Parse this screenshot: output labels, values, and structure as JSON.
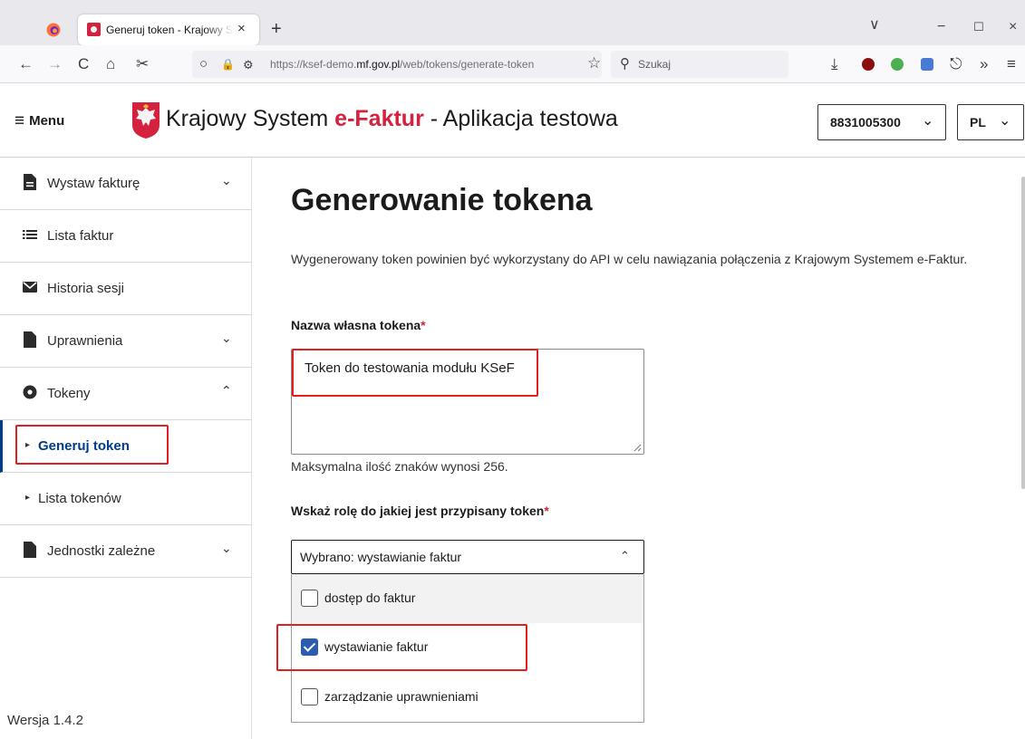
{
  "browser": {
    "tab_title": "Generuj token - Krajowy System e-Faktur",
    "url_prefix": "https://ksef-demo.",
    "url_domain": "mf.gov.pl",
    "url_path": "/web/tokens/generate-token",
    "search_placeholder": "Szukaj",
    "new_tab": "+",
    "tab_close": "×",
    "list_all_tabs": "∨",
    "minimize": "−",
    "maximize": "☐",
    "close": "×",
    "back": "←",
    "forward": "→",
    "reload": "C",
    "home": "⌂",
    "screenshot": "✂",
    "tracking_protection": "○",
    "lock": "🔒",
    "permissions": "⚙",
    "bookmark": "☆",
    "search_icon": "⚲",
    "downloads": "⤓",
    "share": "⎋",
    "overflow": "»",
    "app_menu": "≡"
  },
  "header": {
    "menu_icon": "≡",
    "menu_label": "Menu",
    "brand_prefix": "Krajowy System ",
    "brand_accent": "e-Faktur",
    "brand_suffix": " - Aplikacja testowa",
    "nip": "8831005300",
    "language": "PL",
    "chevron": "⌄"
  },
  "sidebar": {
    "items": [
      {
        "label": "Wystaw fakturę",
        "chevron": "⌄"
      },
      {
        "label": "Lista faktur"
      },
      {
        "label": "Historia sesji"
      },
      {
        "label": "Uprawnienia",
        "chevron": "⌄"
      },
      {
        "label": "Tokeny",
        "chevron": "⌃"
      },
      {
        "label": "Generuj token"
      },
      {
        "label": "Lista tokenów"
      },
      {
        "label": "Jednostki zależne",
        "chevron": "⌄"
      }
    ],
    "submenu_marker": "▸",
    "version": "Wersja 1.4.2"
  },
  "main": {
    "title": "Generowanie tokena",
    "description": "Wygenerowany token powinien być wykorzystany do API w celu nawiązania połączenia z Krajowym Systemem e-Faktur.",
    "name_label": "Nazwa własna tokena",
    "required_mark": "*",
    "name_value": "Token do testowania modułu KSeF",
    "name_hint": "Maksymalna ilość znaków wynosi 256.",
    "role_label": "Wskaż rolę do jakiej jest przypisany token",
    "role_selected": "Wybrano: wystawianie faktur",
    "role_chevron": "⌃",
    "role_options": [
      {
        "label": "dostęp do faktur",
        "checked": false
      },
      {
        "label": "wystawianie faktur",
        "checked": true
      },
      {
        "label": "zarządzanie uprawnieniami",
        "checked": false
      }
    ]
  },
  "colors": {
    "accent_red": "#d4213d",
    "active_blue": "#003c8a",
    "checkbox_blue": "#2a5db0",
    "highlight_red": "#e02020"
  }
}
